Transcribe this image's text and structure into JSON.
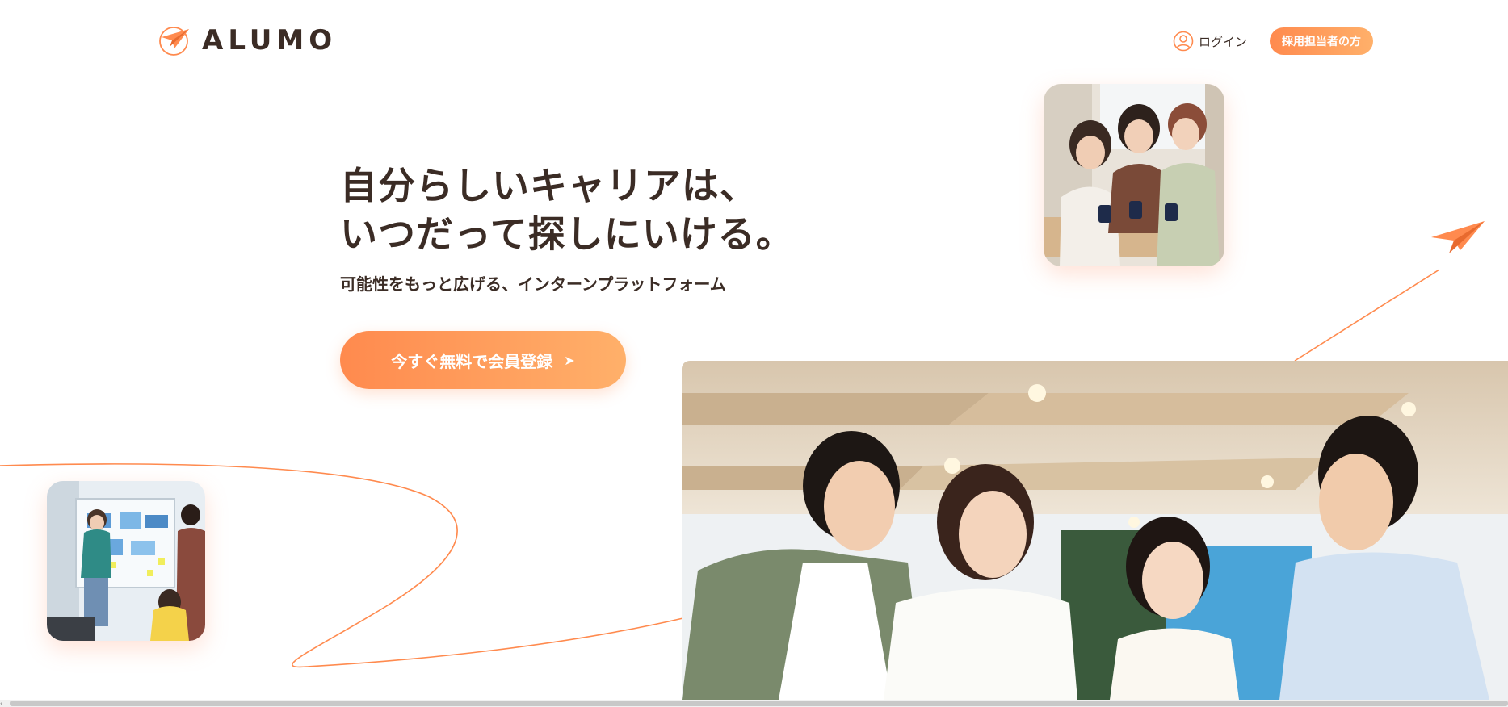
{
  "brand": {
    "name": "ALUMO"
  },
  "header": {
    "login_label": "ログイン",
    "recruiter_label": "採用担当者の方"
  },
  "hero": {
    "headline_line1": "自分らしいキャリアは、",
    "headline_line2": "いつだって探しにいける。",
    "subtitle": "可能性をもっと広げる、インターンプラットフォーム",
    "cta_label": "今すぐ無料で会員登録",
    "cta_arrow": "➤"
  },
  "icons": {
    "logo": "paper-plane-icon",
    "login": "user-circle-icon",
    "decoration": "paper-plane-icon"
  },
  "colors": {
    "accent": "#ff8a4e",
    "accent_light": "#ffb06a",
    "text": "#3b2c25"
  }
}
